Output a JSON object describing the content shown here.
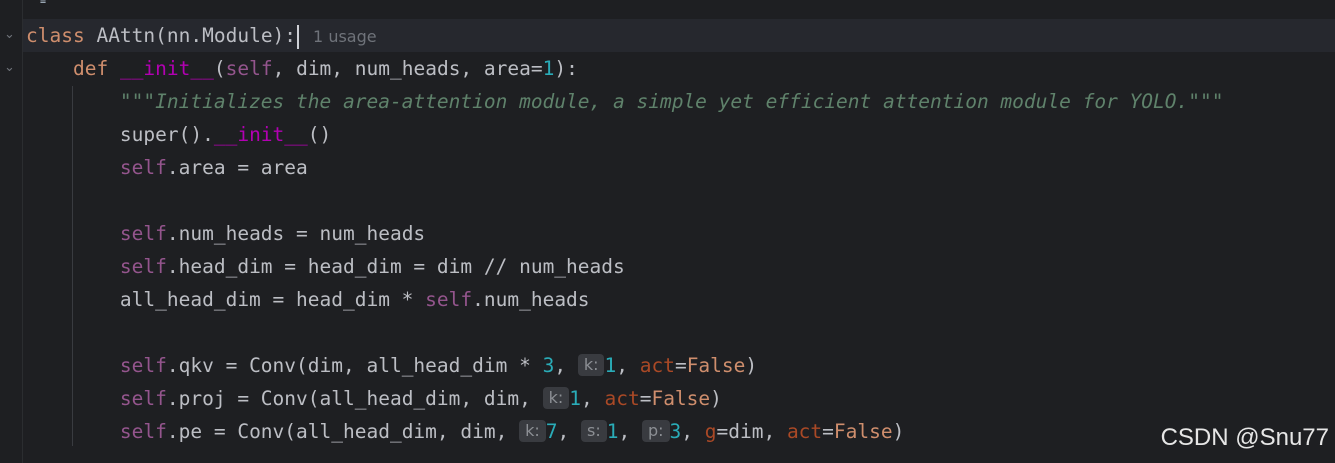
{
  "editor": {
    "usage_hint": "1 usage",
    "lines": {
      "l1": {
        "kw": "class",
        "name": "AAttn(nn.Module):"
      },
      "l2": {
        "kw": "def",
        "dunder": "__init__",
        "p1": "(",
        "self": "self",
        "rest": ", dim, num_heads, area=",
        "num": "1",
        "end": "):"
      },
      "l3": {
        "doc": "\"\"\"Initializes the area-attention module, a simple yet efficient attention module for YOLO.\"\"\""
      },
      "l4": {
        "a": "super().",
        "dunder": "__init__",
        "b": "()"
      },
      "l5": {
        "self": "self",
        "rest": ".area = area"
      },
      "l6": {
        "self": "self",
        "rest": ".num_heads = num_heads"
      },
      "l7": {
        "self": "self",
        "rest": ".head_dim = head_dim = dim // num_heads"
      },
      "l8": {
        "a": "all_head_dim = head_dim * ",
        "self": "self",
        "b": ".num_heads"
      },
      "l9": {
        "self": "self",
        "a": ".qkv = Conv(dim, all_head_dim * ",
        "n1": "3",
        "b": ", ",
        "hint_k": "k:",
        "n2": "1",
        "c": ", ",
        "act": "act",
        "d": "=",
        "false": "False",
        "e": ")"
      },
      "l10": {
        "self": "self",
        "a": ".proj = Conv(all_head_dim, dim, ",
        "hint_k": "k:",
        "n1": "1",
        "b": ", ",
        "act": "act",
        "c": "=",
        "false": "False",
        "d": ")"
      },
      "l11": {
        "self": "self",
        "a": ".pe = Conv(all_head_dim, dim, ",
        "hint_k": "k:",
        "n1": "7",
        "b": ", ",
        "hint_s": "s:",
        "n2": "1",
        "c": ", ",
        "hint_p": "p:",
        "n3": "3",
        "d": ", ",
        "g": "g",
        "e": "=dim, ",
        "act": "act",
        "f": "=",
        "false": "False",
        "h": ")"
      }
    }
  },
  "watermark": "CSDN @Snu77",
  "colors": {
    "background": "#1e1f22",
    "keyword": "#cf8e6d",
    "dunder": "#b200b2",
    "self": "#94558d",
    "number": "#2aacb8",
    "docstring": "#5f826b",
    "named_arg": "#aa4926"
  }
}
